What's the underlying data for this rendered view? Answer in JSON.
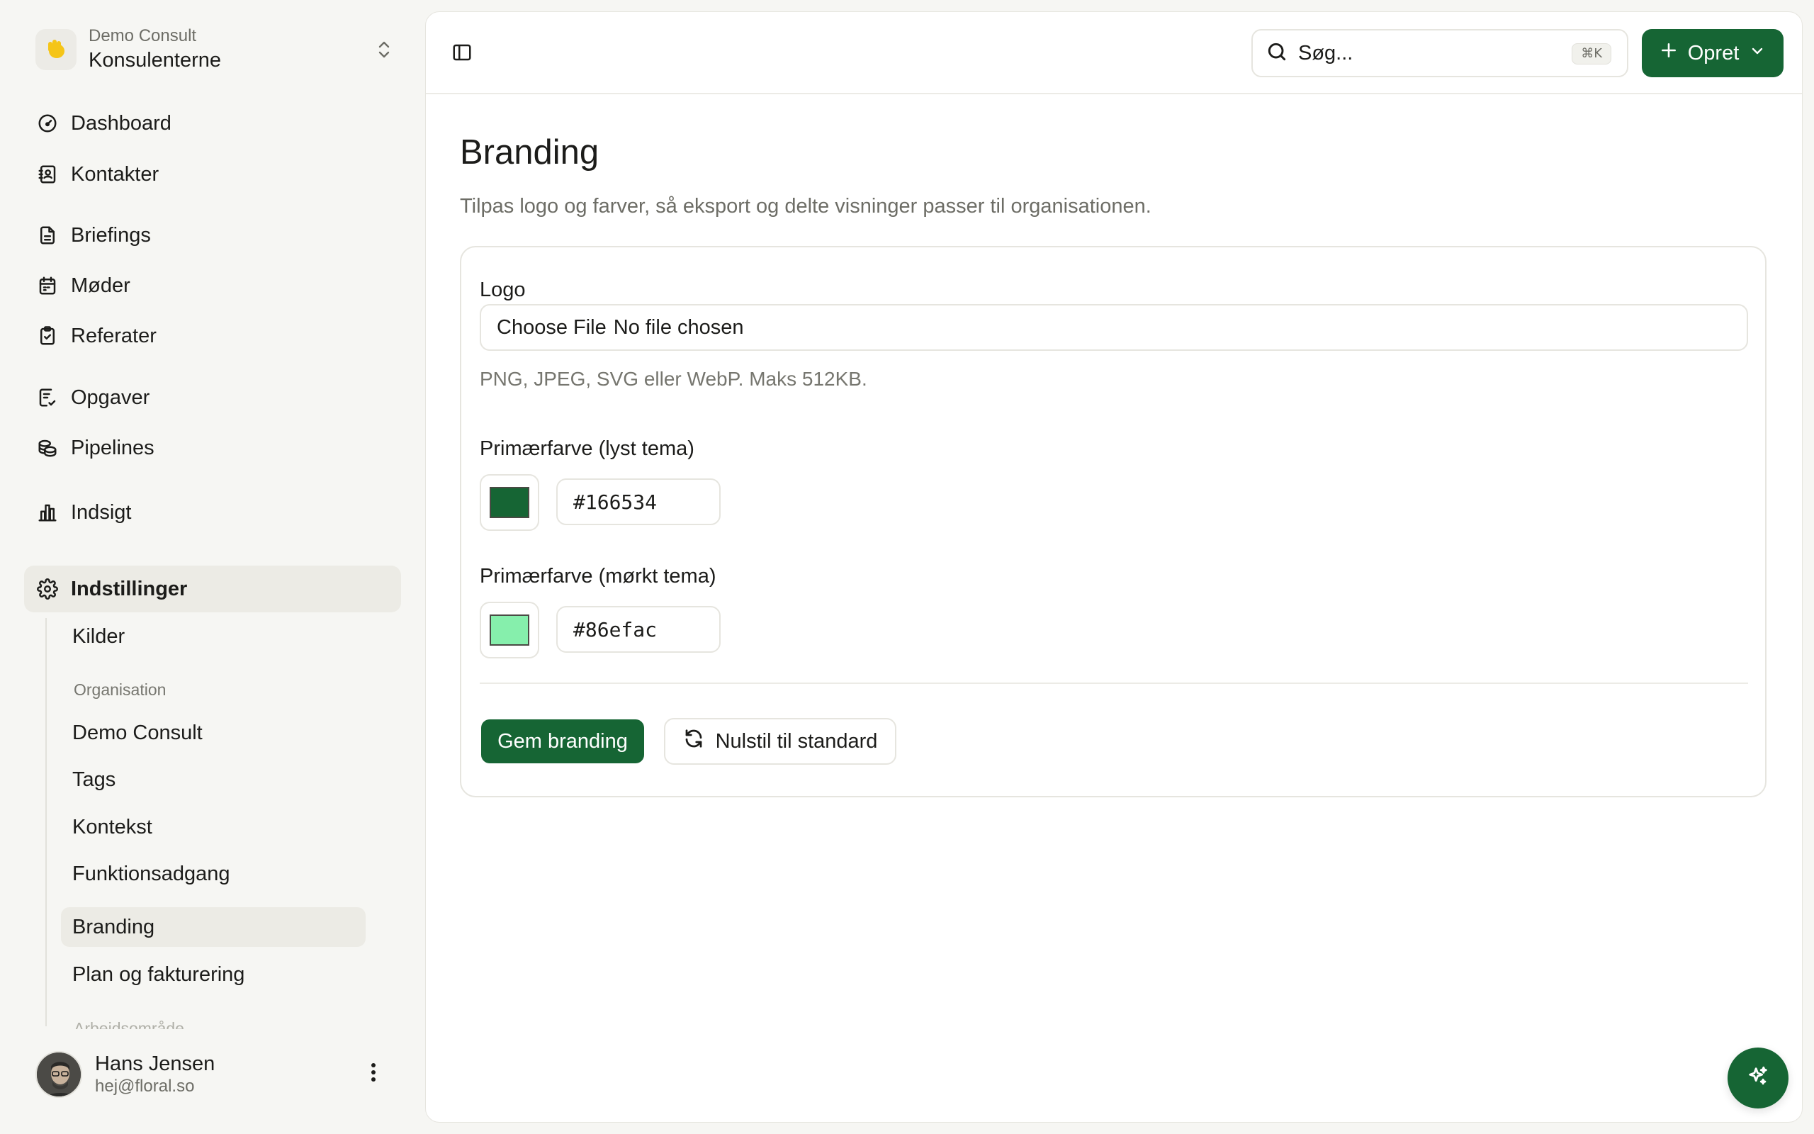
{
  "colors": {
    "accent": "#166534",
    "accent_dark_theme": "#86efac"
  },
  "org": {
    "subtitle": "Demo Consult",
    "name": "Konsulenterne",
    "icon": "hand-emoji-icon"
  },
  "nav": {
    "dashboard": "Dashboard",
    "contacts": "Kontakter",
    "briefings": "Briefings",
    "meetings": "Møder",
    "minutes": "Referater",
    "tasks": "Opgaver",
    "pipelines": "Pipelines",
    "insight": "Indsigt",
    "settings": "Indstillinger"
  },
  "subnav": {
    "sources": "Kilder",
    "org_heading": "Organisation",
    "demo_consult": "Demo Consult",
    "tags": "Tags",
    "context": "Kontekst",
    "feature_access": "Funktionsadgang",
    "branding": "Branding",
    "plan_billing": "Plan og fakturering",
    "workspace_heading": "Arbejdsområde"
  },
  "user": {
    "name": "Hans Jensen",
    "email": "hej@floral.so"
  },
  "topbar": {
    "search_placeholder": "Søg...",
    "search_shortcut": "⌘K",
    "create_label": "Opret"
  },
  "page": {
    "title": "Branding",
    "subtitle": "Tilpas logo og farver, så eksport og delte visninger passer til organisationen."
  },
  "form": {
    "logo_label": "Logo",
    "file_button": "Choose File",
    "file_status": "No file chosen",
    "logo_hint": "PNG, JPEG, SVG eller WebP. Maks 512KB.",
    "primary_light_label": "Primærfarve (lyst tema)",
    "primary_light_value": "#166534",
    "primary_dark_label": "Primærfarve (mørkt tema)",
    "primary_dark_value": "#86efac",
    "save_label": "Gem branding",
    "reset_label": "Nulstil til standard"
  }
}
